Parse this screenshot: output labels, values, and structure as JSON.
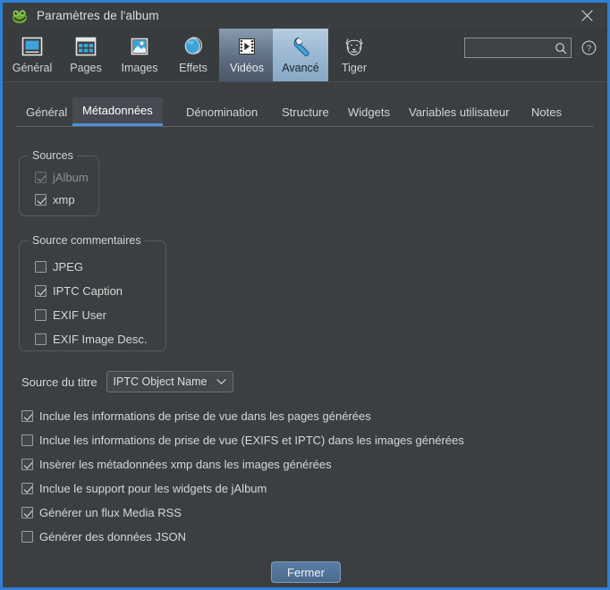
{
  "window": {
    "title": "Paramètres de l'album",
    "app_icon": "frog-icon",
    "close_icon": "close-icon",
    "accent_color": "#2f7fd4",
    "background_color": "#3c3f41"
  },
  "toolbar": {
    "items": [
      {
        "label": "Général",
        "icon": "general-window-icon",
        "state": "normal"
      },
      {
        "label": "Pages",
        "icon": "pages-grid-icon",
        "state": "normal"
      },
      {
        "label": "Images",
        "icon": "image-photo-icon",
        "state": "normal"
      },
      {
        "label": "Effets",
        "icon": "effects-circle-icon",
        "state": "normal"
      },
      {
        "label": "Vidéos",
        "icon": "video-filmstrip-icon",
        "state": "hover"
      },
      {
        "label": "Avancé",
        "icon": "wrench-icon",
        "state": "selected"
      },
      {
        "label": "Tiger",
        "icon": "tiger-head-icon",
        "state": "normal"
      }
    ],
    "search": {
      "value": "",
      "placeholder": "",
      "icon": "search-icon"
    },
    "help": {
      "icon": "help-question-icon"
    }
  },
  "tabs": {
    "items": [
      {
        "label": "Général",
        "active": false
      },
      {
        "label": "Métadonnées",
        "active": true
      },
      {
        "label": "Dénomination",
        "active": false
      },
      {
        "label": "Structure",
        "active": false
      },
      {
        "label": "Widgets",
        "active": false
      },
      {
        "label": "Variables utilisateur",
        "active": false
      },
      {
        "label": "Notes",
        "active": false
      }
    ]
  },
  "sources_group": {
    "title": "Sources",
    "items": [
      {
        "label": "jAlbum",
        "checked": true,
        "disabled": true
      },
      {
        "label": "xmp",
        "checked": true,
        "disabled": false
      }
    ]
  },
  "comment_source_group": {
    "title": "Source commentaires",
    "items": [
      {
        "label": "JPEG",
        "checked": false,
        "disabled": false
      },
      {
        "label": "IPTC Caption",
        "checked": true,
        "disabled": false
      },
      {
        "label": "EXIF User",
        "checked": false,
        "disabled": false
      },
      {
        "label": "EXIF Image Desc.",
        "checked": false,
        "disabled": false
      }
    ]
  },
  "title_source": {
    "label": "Source du titre",
    "value": "IPTC Object Name",
    "chevron_icon": "chevron-down-icon"
  },
  "options": [
    {
      "label": "Inclue les informations de prise de vue dans les pages générées",
      "checked": true
    },
    {
      "label": "Inclue les informations de prise de vue (EXIFS et IPTC) dans les images générées",
      "checked": false
    },
    {
      "label": "Insèrer les métadonnées xmp dans les images générées",
      "checked": true
    },
    {
      "label": "Inclue le support pour les widgets de jAlbum",
      "checked": true
    },
    {
      "label": "Générer un flux Media RSS",
      "checked": true
    },
    {
      "label": "Générer des données JSON",
      "checked": false
    }
  ],
  "footer": {
    "close_label": "Fermer"
  }
}
